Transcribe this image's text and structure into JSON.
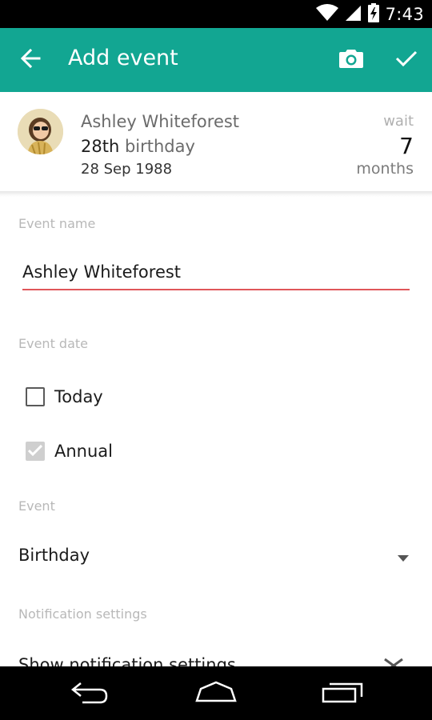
{
  "status_bar": {
    "time": "7:43",
    "icons": [
      "wifi-icon",
      "signal-icon",
      "battery-charging-icon"
    ]
  },
  "app_bar": {
    "title": "Add event",
    "color": "#12a692",
    "icons": [
      "back-arrow-icon",
      "camera-icon",
      "check-icon"
    ]
  },
  "summary": {
    "name": "Ashley Whiteforest",
    "age": "28th",
    "event_kind": "birthday",
    "date": "28 Sep 1988",
    "wait_label": "wait",
    "wait_value": "7",
    "wait_unit": "months"
  },
  "form": {
    "event_name_label": "Event name",
    "event_name_value": "Ashley Whiteforest",
    "event_date_label": "Event date",
    "today_label": "Today",
    "today_checked": false,
    "annual_label": "Annual",
    "annual_checked": true,
    "event_label": "Event",
    "event_value": "Birthday",
    "notification_label": "Notification settings",
    "show_notification_label": "Show notification settings"
  },
  "nav_bar": {
    "icons": [
      "back-nav-icon",
      "home-nav-icon",
      "recents-nav-icon"
    ]
  }
}
